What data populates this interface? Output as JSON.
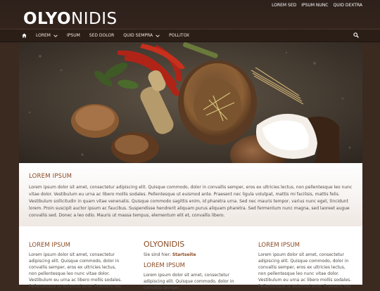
{
  "logo": {
    "bold": "OLYO",
    "thin": "NIDIS"
  },
  "top_links": [
    "LOREM SED",
    "IPSUM NUNC",
    "QUID DEXTRA"
  ],
  "nav": {
    "items": [
      {
        "label": "LOREM",
        "has_dropdown": true
      },
      {
        "label": "IPSUM",
        "has_dropdown": false
      },
      {
        "label": "SED DOLOR",
        "has_dropdown": false
      },
      {
        "label": "QUID SEMPRA",
        "has_dropdown": true
      },
      {
        "label": "POLLITOX",
        "has_dropdown": false
      }
    ]
  },
  "intro": {
    "heading": "LOREM IPSUM",
    "text": "Lorem ipsum dolor sit amet, consectetur adipiscing elit. Quisque commodo, dolor in convallis semper, eros ex ultricies lectus, non pellentesque leo nunc vitae dolor. Vestibulum eu urna ac libero mollis sodales. Pellentesque ut euismod ante. Praesent nec ligula volutpat, mattis mi facilisis, mattis felis. Vestibulum sollicitudin in quam vitae venenatis. Quisque commodo sagittis enim, id pharetra urna. Sed nec mauris tempor, varius nunc eget, tincidunt lorem. Proin suscipit auctor ipsum ac faucibus. Suspendisse hendrerit aliquam purus aliquam pharetra. Sed fermentum nunc magna, sed laoreet augue convallis sed. Donec a leo odio. Mauris ut massa tempus, elementum elit et, convallis libero."
  },
  "left_column": {
    "heading": "LOREM IPSUM",
    "text": "Lorem ipsum dolor sit amet, consectetur adipiscing elit. Quisque commodo, dolor in convallis semper, eros ex ultricies lectus, non pellentesque leo nunc vitae dolor. Vestibulum eu urna ac libero mollis sodales. Pellentesque ut euismod ante. Praesent nec"
  },
  "center_column": {
    "page_title": "OLYONIDIS",
    "breadcrumb_prefix": "Sie sind hier: ",
    "breadcrumb_link": "Startseite",
    "heading": "LOREM IPSUM",
    "text": "Lorem ipsum dolor sit amet, consectetur adipiscing elit. Quisque commodo, dolor in convallis semper."
  },
  "right_column": {
    "heading": "LOREM IPSUM",
    "text": "Lorem ipsum dolor sit amet, consectetur adipiscing elit. Quisque commodo, dolor in convallis semper, eros ex ultricies lectus, non pellentesque leo nunc vitae dolor. Vestibulum eu urna ac libero mollis sodales. Pellentesque ut euismod ante. Praesent nec"
  },
  "icons": {
    "home": "home-icon",
    "search": "search-icon",
    "dropdown": "chevron-down-icon"
  },
  "colors": {
    "background": "#3b2a20",
    "header": "#2d201a",
    "accent": "#8a4a23",
    "text": "#4f4a46"
  }
}
